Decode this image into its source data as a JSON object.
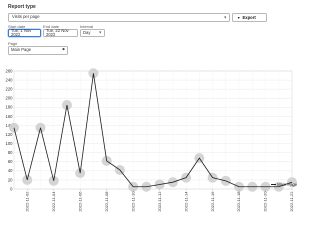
{
  "report": {
    "title": "Report type",
    "type_value": "Visits per page",
    "export_label": "Export",
    "start_label": "Start date",
    "start_value": "Tue, 1 Nov 2022",
    "end_label": "End date",
    "end_value": "Tue, 22 Nov 2022",
    "interval_label": "Interval",
    "interval_value": "Day",
    "page_label": "Page",
    "page_value": "Main Page"
  },
  "colors": {
    "line": "#1f1f1f",
    "point": "#cfcfcf",
    "grid": "#e3e3e3",
    "accent": "#3b7bd8"
  },
  "chart_data": {
    "type": "line",
    "x": [
      "2022-11-01",
      "2022-11-02",
      "2022-11-03",
      "2022-11-04",
      "2022-11-05",
      "2022-11-06",
      "2022-11-07",
      "2022-11-08",
      "2022-11-09",
      "2022-11-10",
      "2022-11-11",
      "2022-11-12",
      "2022-11-13",
      "2022-11-14",
      "2022-11-15",
      "2022-11-16",
      "2022-11-17",
      "2022-11-18",
      "2022-11-19",
      "2022-11-20",
      "2022-11-21",
      "2022-11-22"
    ],
    "x_tick_labels": [
      "2022-11-02",
      "2022-11-04",
      "2022-11-06",
      "2022-11-08",
      "2022-11-10",
      "2022-11-12",
      "2022-11-14",
      "2022-11-16",
      "2022-11-18",
      "2022-11-20",
      "2022-11-22"
    ],
    "series": [
      {
        "name": "Main Page",
        "values": [
          135,
          20,
          135,
          18,
          185,
          35,
          255,
          62,
          42,
          5,
          5,
          10,
          15,
          25,
          68,
          25,
          18,
          5,
          5,
          5,
          5,
          15
        ]
      }
    ],
    "ylim": [
      0,
      260
    ],
    "y_ticks": [
      0,
      20,
      40,
      60,
      80,
      100,
      120,
      140,
      160,
      180,
      200,
      220,
      240,
      260
    ],
    "grid": true,
    "legend": "bottom-right"
  }
}
